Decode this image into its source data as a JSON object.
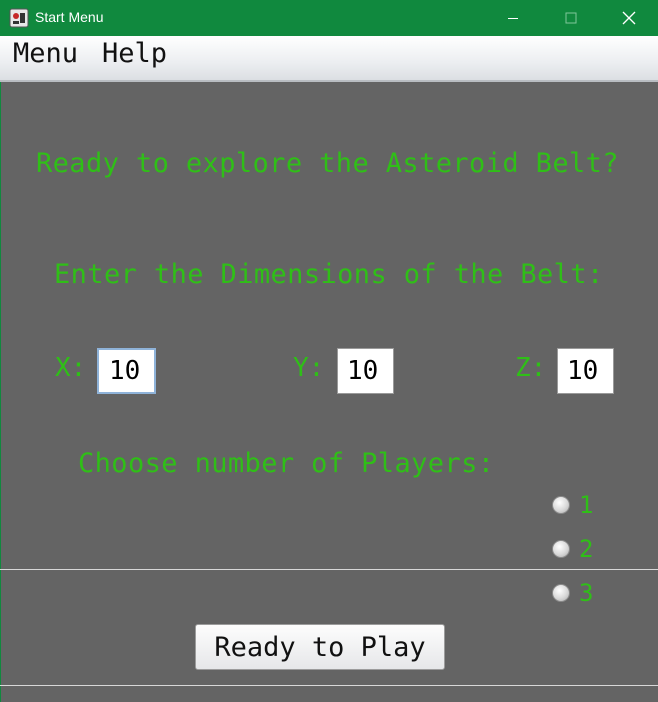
{
  "window": {
    "title": "Start Menu",
    "titlebar_color": "#10893e",
    "icons": [
      "app-icon",
      "minimize-icon",
      "maximize-icon",
      "close-icon"
    ]
  },
  "menubar": {
    "items": [
      {
        "label": "Menu"
      },
      {
        "label": "Help"
      }
    ]
  },
  "main": {
    "headline": "Ready to explore the Asteroid Belt?",
    "dimensions_prompt": "Enter the Dimensions of the Belt:",
    "dimensions": {
      "x": {
        "label": "X:",
        "value": "10"
      },
      "y": {
        "label": "Y:",
        "value": "10"
      },
      "z": {
        "label": "Z:",
        "value": "10"
      }
    },
    "players_prompt": "Choose number of Players:",
    "players_options": [
      {
        "label": "1",
        "selected": false
      },
      {
        "label": "2",
        "selected": false
      },
      {
        "label": "3",
        "selected": false
      }
    ],
    "play_button": "Ready to Play",
    "text_color": "#2fbf17",
    "background_color": "#646464"
  }
}
